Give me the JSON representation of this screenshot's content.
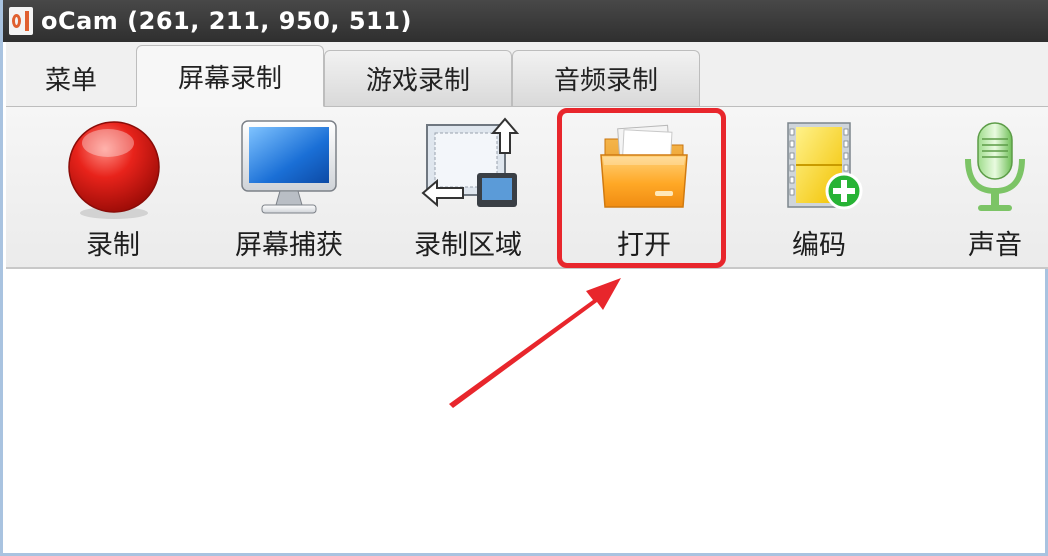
{
  "window": {
    "title": "oCam (261, 211, 950, 511)",
    "app_icon": "ocam-logo-icon"
  },
  "tabs": [
    {
      "label": "菜单",
      "active": false
    },
    {
      "label": "屏幕录制",
      "active": true
    },
    {
      "label": "游戏录制",
      "active": false
    },
    {
      "label": "音频录制",
      "active": false
    }
  ],
  "toolbar": {
    "items": [
      {
        "label": "录制",
        "icon": "record-icon"
      },
      {
        "label": "屏幕捕获",
        "icon": "monitor-icon"
      },
      {
        "label": "录制区域",
        "icon": "region-resize-icon"
      },
      {
        "label": "打开",
        "icon": "folder-icon"
      },
      {
        "label": "编码",
        "icon": "film-add-icon"
      },
      {
        "label": "声音",
        "icon": "microphone-icon"
      }
    ]
  },
  "annotation": {
    "highlight_color": "#e8262c",
    "target": "打开"
  }
}
